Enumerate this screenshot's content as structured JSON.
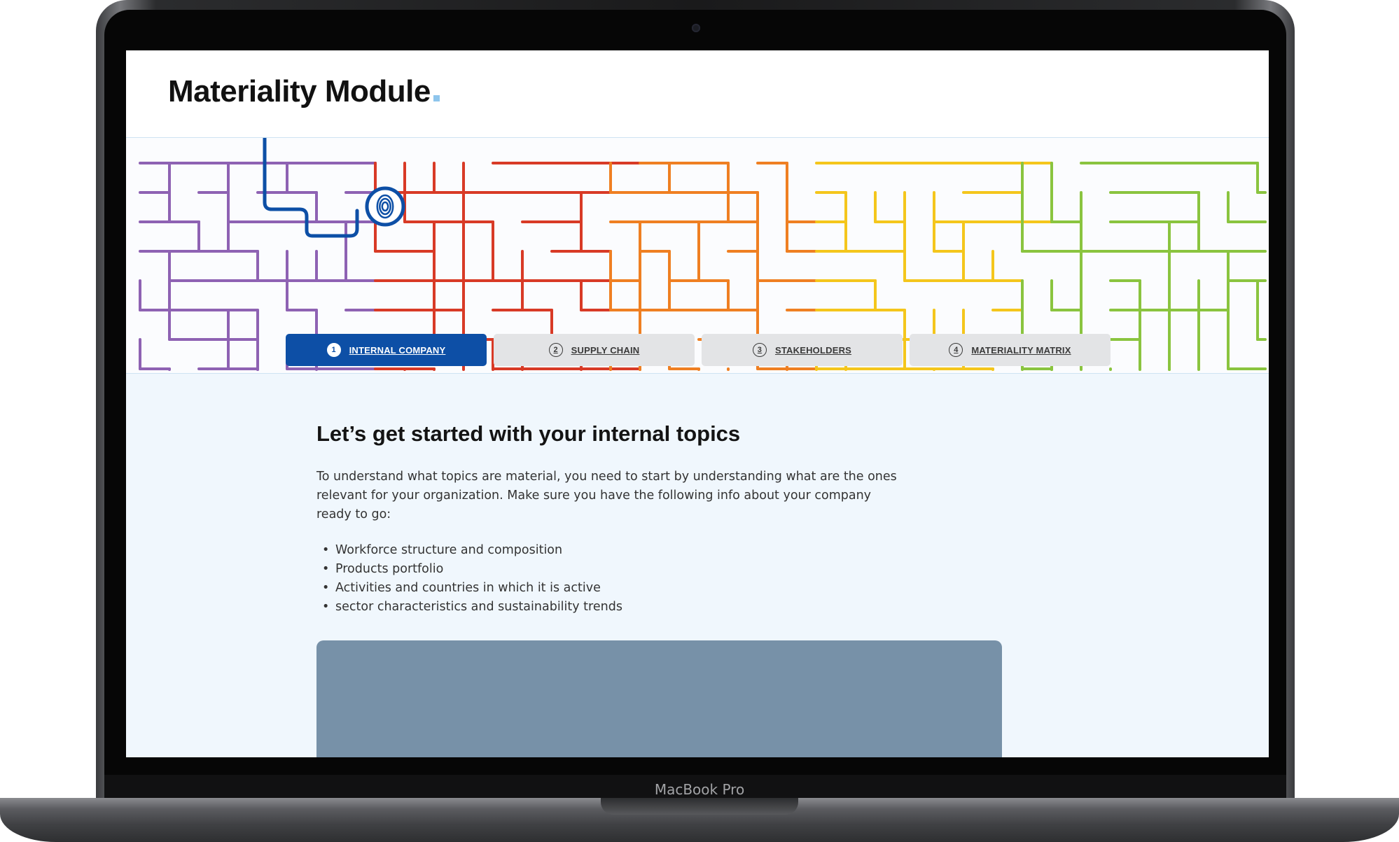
{
  "device": {
    "label": "MacBook Pro"
  },
  "page": {
    "title": "Materiality Module",
    "accent_color": "#0d4fa6",
    "title_dot_color": "#8ec5ec"
  },
  "hero": {
    "icon": "fingerprint-icon"
  },
  "tabs": [
    {
      "num": "1",
      "label": "INTERNAL COMPANY",
      "active": true
    },
    {
      "num": "2",
      "label": "SUPPLY CHAIN",
      "active": false
    },
    {
      "num": "3",
      "label": "STAKEHOLDERS",
      "active": false
    },
    {
      "num": "4",
      "label": "MATERIALITY MATRIX",
      "active": false
    }
  ],
  "content": {
    "heading": "Let’s get started with your internal topics",
    "intro": "To understand what topics are material, you need to start by understanding what are the ones relevant for your organization. Make sure you have the following info about your company ready to go:",
    "items": [
      "Workforce structure and composition",
      "Products portfolio",
      "Activities and countries in which it is active",
      "sector characteristics and sustainability trends"
    ]
  },
  "colors": {
    "maze": [
      "#8e62b3",
      "#d83a26",
      "#ef7f22",
      "#f4c61c",
      "#8ac43f"
    ],
    "media_placeholder": "#7791a8"
  }
}
